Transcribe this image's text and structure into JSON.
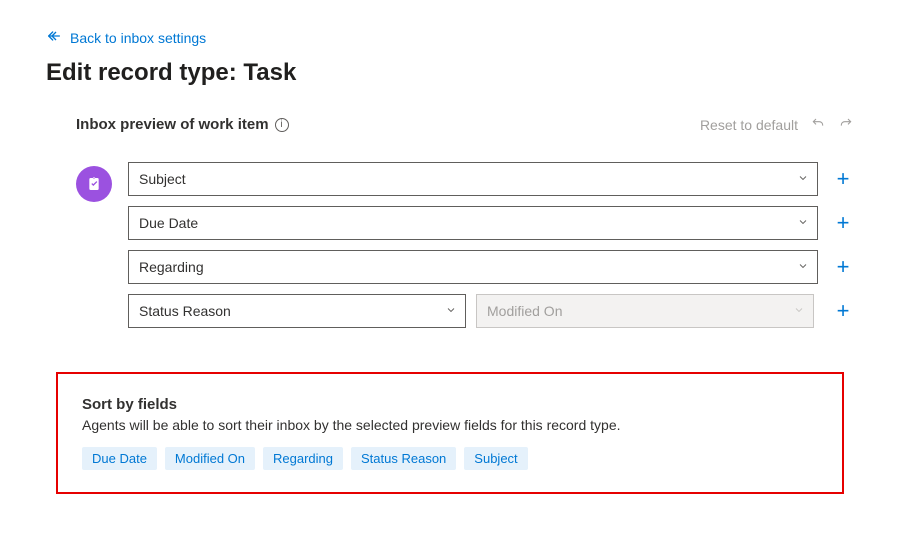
{
  "back_label": "Back to inbox settings",
  "page_title": "Edit record type: Task",
  "preview": {
    "section_label": "Inbox preview of work item",
    "reset_label": "Reset to default",
    "rows": [
      {
        "cells": [
          {
            "value": "Subject",
            "disabled": false
          }
        ]
      },
      {
        "cells": [
          {
            "value": "Due Date",
            "disabled": false
          }
        ]
      },
      {
        "cells": [
          {
            "value": "Regarding",
            "disabled": false
          }
        ]
      },
      {
        "cells": [
          {
            "value": "Status Reason",
            "disabled": false
          },
          {
            "value": "Modified On",
            "disabled": true
          }
        ]
      }
    ]
  },
  "sort_panel": {
    "title": "Sort by fields",
    "description": "Agents will be able to sort their inbox by the selected preview fields for this record type.",
    "chips": [
      "Due Date",
      "Modified On",
      "Regarding",
      "Status Reason",
      "Subject"
    ]
  }
}
